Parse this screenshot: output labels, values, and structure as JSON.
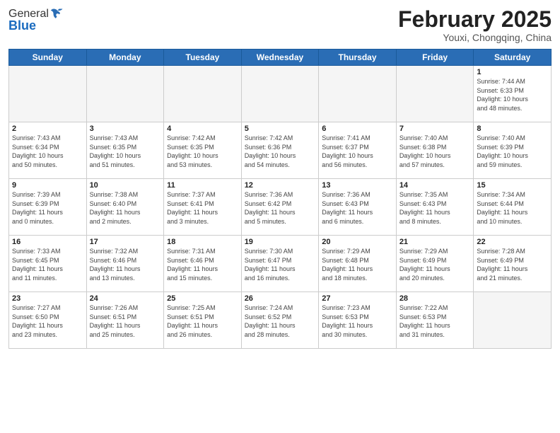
{
  "header": {
    "logo_line1": "General",
    "logo_line2": "Blue",
    "title": "February 2025",
    "subtitle": "Youxi, Chongqing, China"
  },
  "weekdays": [
    "Sunday",
    "Monday",
    "Tuesday",
    "Wednesday",
    "Thursday",
    "Friday",
    "Saturday"
  ],
  "weeks": [
    [
      {
        "day": "",
        "info": ""
      },
      {
        "day": "",
        "info": ""
      },
      {
        "day": "",
        "info": ""
      },
      {
        "day": "",
        "info": ""
      },
      {
        "day": "",
        "info": ""
      },
      {
        "day": "",
        "info": ""
      },
      {
        "day": "1",
        "info": "Sunrise: 7:44 AM\nSunset: 6:33 PM\nDaylight: 10 hours\nand 48 minutes."
      }
    ],
    [
      {
        "day": "2",
        "info": "Sunrise: 7:43 AM\nSunset: 6:34 PM\nDaylight: 10 hours\nand 50 minutes."
      },
      {
        "day": "3",
        "info": "Sunrise: 7:43 AM\nSunset: 6:35 PM\nDaylight: 10 hours\nand 51 minutes."
      },
      {
        "day": "4",
        "info": "Sunrise: 7:42 AM\nSunset: 6:35 PM\nDaylight: 10 hours\nand 53 minutes."
      },
      {
        "day": "5",
        "info": "Sunrise: 7:42 AM\nSunset: 6:36 PM\nDaylight: 10 hours\nand 54 minutes."
      },
      {
        "day": "6",
        "info": "Sunrise: 7:41 AM\nSunset: 6:37 PM\nDaylight: 10 hours\nand 56 minutes."
      },
      {
        "day": "7",
        "info": "Sunrise: 7:40 AM\nSunset: 6:38 PM\nDaylight: 10 hours\nand 57 minutes."
      },
      {
        "day": "8",
        "info": "Sunrise: 7:40 AM\nSunset: 6:39 PM\nDaylight: 10 hours\nand 59 minutes."
      }
    ],
    [
      {
        "day": "9",
        "info": "Sunrise: 7:39 AM\nSunset: 6:39 PM\nDaylight: 11 hours\nand 0 minutes."
      },
      {
        "day": "10",
        "info": "Sunrise: 7:38 AM\nSunset: 6:40 PM\nDaylight: 11 hours\nand 2 minutes."
      },
      {
        "day": "11",
        "info": "Sunrise: 7:37 AM\nSunset: 6:41 PM\nDaylight: 11 hours\nand 3 minutes."
      },
      {
        "day": "12",
        "info": "Sunrise: 7:36 AM\nSunset: 6:42 PM\nDaylight: 11 hours\nand 5 minutes."
      },
      {
        "day": "13",
        "info": "Sunrise: 7:36 AM\nSunset: 6:43 PM\nDaylight: 11 hours\nand 6 minutes."
      },
      {
        "day": "14",
        "info": "Sunrise: 7:35 AM\nSunset: 6:43 PM\nDaylight: 11 hours\nand 8 minutes."
      },
      {
        "day": "15",
        "info": "Sunrise: 7:34 AM\nSunset: 6:44 PM\nDaylight: 11 hours\nand 10 minutes."
      }
    ],
    [
      {
        "day": "16",
        "info": "Sunrise: 7:33 AM\nSunset: 6:45 PM\nDaylight: 11 hours\nand 11 minutes."
      },
      {
        "day": "17",
        "info": "Sunrise: 7:32 AM\nSunset: 6:46 PM\nDaylight: 11 hours\nand 13 minutes."
      },
      {
        "day": "18",
        "info": "Sunrise: 7:31 AM\nSunset: 6:46 PM\nDaylight: 11 hours\nand 15 minutes."
      },
      {
        "day": "19",
        "info": "Sunrise: 7:30 AM\nSunset: 6:47 PM\nDaylight: 11 hours\nand 16 minutes."
      },
      {
        "day": "20",
        "info": "Sunrise: 7:29 AM\nSunset: 6:48 PM\nDaylight: 11 hours\nand 18 minutes."
      },
      {
        "day": "21",
        "info": "Sunrise: 7:29 AM\nSunset: 6:49 PM\nDaylight: 11 hours\nand 20 minutes."
      },
      {
        "day": "22",
        "info": "Sunrise: 7:28 AM\nSunset: 6:49 PM\nDaylight: 11 hours\nand 21 minutes."
      }
    ],
    [
      {
        "day": "23",
        "info": "Sunrise: 7:27 AM\nSunset: 6:50 PM\nDaylight: 11 hours\nand 23 minutes."
      },
      {
        "day": "24",
        "info": "Sunrise: 7:26 AM\nSunset: 6:51 PM\nDaylight: 11 hours\nand 25 minutes."
      },
      {
        "day": "25",
        "info": "Sunrise: 7:25 AM\nSunset: 6:51 PM\nDaylight: 11 hours\nand 26 minutes."
      },
      {
        "day": "26",
        "info": "Sunrise: 7:24 AM\nSunset: 6:52 PM\nDaylight: 11 hours\nand 28 minutes."
      },
      {
        "day": "27",
        "info": "Sunrise: 7:23 AM\nSunset: 6:53 PM\nDaylight: 11 hours\nand 30 minutes."
      },
      {
        "day": "28",
        "info": "Sunrise: 7:22 AM\nSunset: 6:53 PM\nDaylight: 11 hours\nand 31 minutes."
      },
      {
        "day": "",
        "info": ""
      }
    ]
  ]
}
